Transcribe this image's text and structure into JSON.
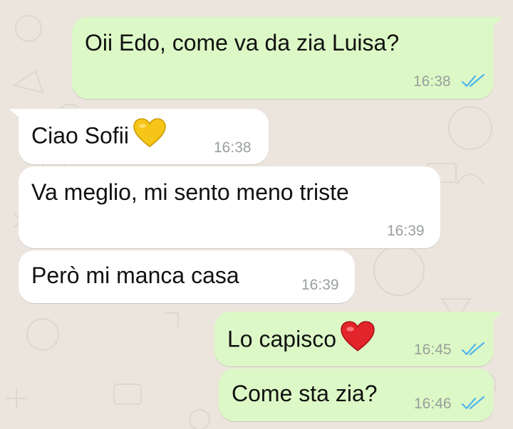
{
  "chat": {
    "messages": [
      {
        "direction": "outgoing",
        "text": "Oii Edo, come va da zia Luisa?",
        "time": "16:38",
        "status": "read",
        "emoji": ""
      },
      {
        "direction": "incoming",
        "text": "Ciao Sofii",
        "time": "16:38",
        "emoji": "yellow-heart"
      },
      {
        "direction": "incoming",
        "text": "Va meglio, mi sento meno triste",
        "time": "16:39",
        "emoji": ""
      },
      {
        "direction": "incoming",
        "text": "Però mi manca casa",
        "time": "16:39",
        "emoji": ""
      },
      {
        "direction": "outgoing",
        "text": "Lo capisco",
        "time": "16:45",
        "status": "read",
        "emoji": "red-heart"
      },
      {
        "direction": "outgoing",
        "text": "Come sta zia?",
        "time": "16:46",
        "status": "read",
        "emoji": ""
      }
    ]
  },
  "colors": {
    "background": "#ECE5DD",
    "outgoing_bubble": "#DCF8C6",
    "incoming_bubble": "#FFFFFF",
    "read_ticks": "#4FB6EC",
    "timestamp": "#9AA09A"
  }
}
